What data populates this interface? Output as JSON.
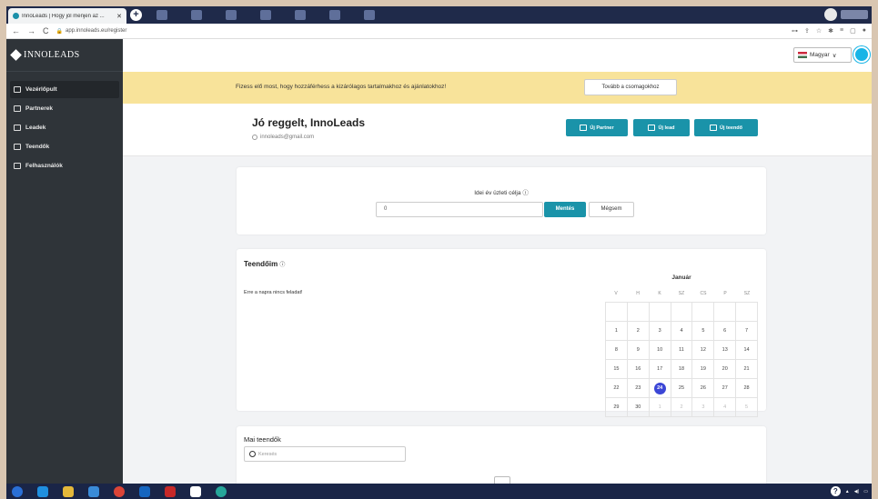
{
  "browser": {
    "tab_title": "InnoLeads | Hogy jól menjen az ...",
    "tab_close": "✕",
    "new_tab": "+",
    "url": "app.innoleads.eu/register",
    "nav_back": "←",
    "nav_forward": "→",
    "nav_reload": "C"
  },
  "sidebar": {
    "logo": "INNOLEADS",
    "items": [
      {
        "label": "Vezérlőpult",
        "icon": "home-icon"
      },
      {
        "label": "Partnerek",
        "icon": "users-icon"
      },
      {
        "label": "Leadek",
        "icon": "leads-icon"
      },
      {
        "label": "Teendők",
        "icon": "calendar-icon"
      },
      {
        "label": "Felhasználók",
        "icon": "user-box-icon"
      }
    ]
  },
  "topbar": {
    "language": "Magyar",
    "language_chevron": "∨"
  },
  "banner": {
    "message": "Fizess elő most, hogy hozzáférhess a kizárólagos tartalmakhoz és ajánlatokhoz!",
    "button": "Tovább a csomagokhoz"
  },
  "greeting": {
    "title": "Jó reggelt, InnoLeads",
    "email": "innoleads@gmail.com",
    "actions": {
      "new_partner": "Új Partner",
      "new_lead": "Új lead",
      "new_todo": "Új teendő"
    }
  },
  "goal": {
    "label": "Idei év üzleti célja",
    "value": "0",
    "save": "Mentés",
    "cancel": "Mégsem"
  },
  "todos": {
    "title": "Teendőim",
    "empty": "Erre a napra nincs feladat!",
    "calendar": {
      "month": "Január",
      "weekdays": [
        "V",
        "H",
        "K",
        "SZ",
        "CS",
        "P",
        "SZ"
      ],
      "weeks": [
        [
          "",
          "",
          "",
          "",
          "",
          "",
          ""
        ],
        [
          "1",
          "2",
          "3",
          "4",
          "5",
          "6",
          "7"
        ],
        [
          "8",
          "9",
          "10",
          "11",
          "12",
          "13",
          "14"
        ],
        [
          "15",
          "16",
          "17",
          "18",
          "19",
          "20",
          "21"
        ],
        [
          "22",
          "23",
          "24",
          "25",
          "26",
          "27",
          "28"
        ],
        [
          "29",
          "30",
          "1",
          "2",
          "3",
          "4",
          "5"
        ]
      ],
      "today": "24"
    }
  },
  "today_todos": {
    "title": "Mai teendők",
    "search_placeholder": "Keresés"
  },
  "colors": {
    "sidebar": "#2f3439",
    "accent": "#1a93a9",
    "banner": "#f8e39a",
    "today": "#3b46d6"
  }
}
